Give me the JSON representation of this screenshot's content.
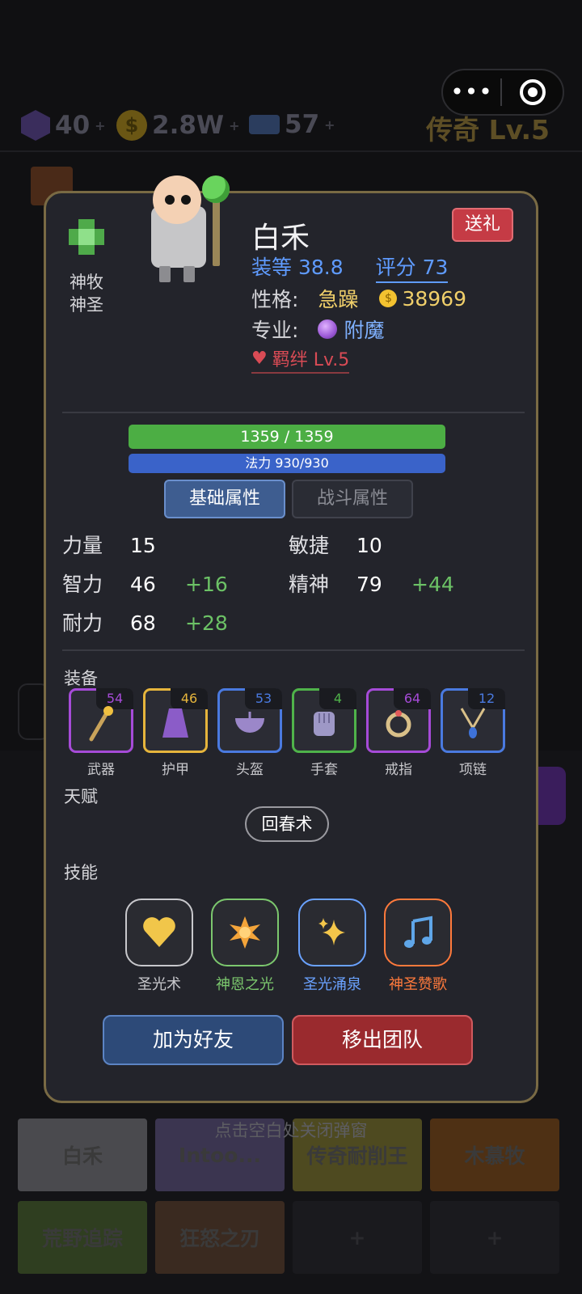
{
  "resources": {
    "gems": "40",
    "gold": "2.8W",
    "tickets": "57",
    "plus": "+"
  },
  "rank": {
    "label": "传奇 Lv.5"
  },
  "capsule": {
    "more": "•••"
  },
  "background": {
    "hint": "点击空白处关闭弹窗",
    "tiles_row1": [
      "白禾",
      "Intoo...",
      "传奇耐削王",
      "木慕牧"
    ],
    "tiles_row2": [
      "荒野追踪",
      "狂怒之刃",
      "+",
      "+"
    ]
  },
  "hero": {
    "class_line1": "神牧",
    "class_line2": "神圣",
    "name": "白禾",
    "gift_label": "送礼",
    "gear_score": "装等 38.8",
    "rating": "评分 73",
    "temper_label": "性格:",
    "temper": "急躁",
    "coin_symbol": "$",
    "money": "38969",
    "profession_label": "专业:",
    "profession": "附魔",
    "bond": "羁绊 Lv.5"
  },
  "bars": {
    "hp_text": "1359 / 1359",
    "hp_fraction": 1.0,
    "mp_text": "法力 930/930",
    "mp_fraction": 1.0
  },
  "tabs": {
    "base": "基础属性",
    "battle": "战斗属性"
  },
  "stats": {
    "str_label": "力量",
    "str": "15",
    "agi_label": "敏捷",
    "agi": "10",
    "int_label": "智力",
    "int": "46",
    "int_bonus": "+16",
    "spi_label": "精神",
    "spi": "79",
    "spi_bonus": "+44",
    "sta_label": "耐力",
    "sta": "68",
    "sta_bonus": "+28"
  },
  "sections": {
    "equipment": "装备",
    "talent": "天赋",
    "skills": "技能"
  },
  "equipment": [
    {
      "label": "武器",
      "level": "54",
      "color": "#a64bd8"
    },
    {
      "label": "护甲",
      "level": "46",
      "color": "#e6b53c"
    },
    {
      "label": "头盔",
      "level": "53",
      "color": "#4a7ae0"
    },
    {
      "label": "手套",
      "level": "4",
      "color": "#4fb34a"
    },
    {
      "label": "戒指",
      "level": "64",
      "color": "#a64bd8"
    },
    {
      "label": "项链",
      "level": "12",
      "color": "#4a7ae0"
    }
  ],
  "talent": {
    "name": "回春术"
  },
  "skills": [
    {
      "label": "圣光术",
      "icon": "heart-icon",
      "color": "#c8c8cc"
    },
    {
      "label": "神恩之光",
      "icon": "burst-icon",
      "color": "#7cc86e"
    },
    {
      "label": "圣光涌泉",
      "icon": "sparkle-icon",
      "color": "#6aa2ff"
    },
    {
      "label": "神圣赞歌",
      "icon": "music-icon",
      "color": "#ff7a3c"
    }
  ],
  "actions": {
    "add_friend": "加为好友",
    "remove_team": "移出团队"
  }
}
